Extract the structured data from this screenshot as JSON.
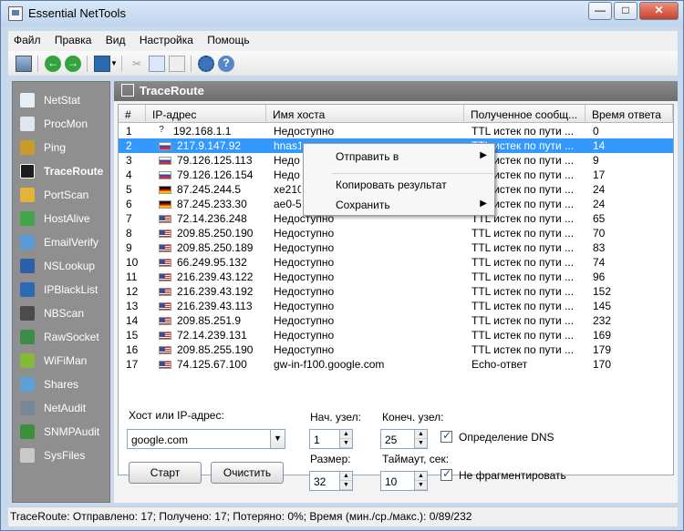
{
  "window": {
    "title": "Essential NetTools",
    "buttons": [
      "—",
      "□",
      "✕"
    ]
  },
  "menu": [
    "Файл",
    "Правка",
    "Вид",
    "Настройка",
    "Помощь"
  ],
  "toolbar": {
    "icons": [
      "computer-icon",
      "back-icon",
      "forward-icon",
      "save-icon",
      "dropdown-icon",
      "cut-icon",
      "copy-icon",
      "paste-icon",
      "settings-icon",
      "help-icon"
    ]
  },
  "sidebar": {
    "items": [
      {
        "label": "NetStat",
        "icon": "netstat-icon",
        "color": "#e6eef7"
      },
      {
        "label": "ProcMon",
        "icon": "procmon-icon",
        "color": "#dfe6f1"
      },
      {
        "label": "Ping",
        "icon": "ping-icon",
        "color": "#c99b2c"
      },
      {
        "label": "TraceRoute",
        "icon": "traceroute-icon",
        "color": "#1d1d1d",
        "active": true
      },
      {
        "label": "PortScan",
        "icon": "portscan-icon",
        "color": "#e5b33a"
      },
      {
        "label": "HostAlive",
        "icon": "hostalive-icon",
        "color": "#41a54b"
      },
      {
        "label": "EmailVerify",
        "icon": "email-icon",
        "color": "#5a9ad6"
      },
      {
        "label": "NSLookup",
        "icon": "nslookup-icon",
        "color": "#2f5da8"
      },
      {
        "label": "IPBlackList",
        "icon": "blacklist-icon",
        "color": "#2f69b2"
      },
      {
        "label": "NBScan",
        "icon": "nbscan-icon",
        "color": "#4b4b4b"
      },
      {
        "label": "RawSocket",
        "icon": "rawsocket-icon",
        "color": "#3e8c4a"
      },
      {
        "label": "WiFiMan",
        "icon": "wifi-icon",
        "color": "#86b93a"
      },
      {
        "label": "Shares",
        "icon": "shares-icon",
        "color": "#5ba1d8"
      },
      {
        "label": "NetAudit",
        "icon": "netaudit-icon",
        "color": "#7b8796"
      },
      {
        "label": "SNMPAudit",
        "icon": "snmp-icon",
        "color": "#3f8e3d"
      },
      {
        "label": "SysFiles",
        "icon": "sysfiles-icon",
        "color": "#c9c9c9"
      }
    ]
  },
  "panel": {
    "title": "TraceRoute"
  },
  "table": {
    "headers": [
      "#",
      "IP-адрес",
      "Имя хоста",
      "Полученное сообщ...",
      "Время ответа"
    ],
    "rows": [
      {
        "n": "1",
        "flag": "unk",
        "ip": "192.168.1.1",
        "host": "Недоступно",
        "msg": "TTL истек по пути ...",
        "time": "0"
      },
      {
        "n": "2",
        "flag": "ru",
        "ip": "217.9.147.92",
        "host": "hnas1.",
        "msg": "TTL истек по пути ...",
        "time": "14",
        "selected": true
      },
      {
        "n": "3",
        "flag": "ru",
        "ip": "79.126.125.113",
        "host": "Недо",
        "msg": "TTL истек по пути ...",
        "time": "9"
      },
      {
        "n": "4",
        "flag": "ru",
        "ip": "79.126.126.154",
        "host": "Недо",
        "msg": "TTL истек по пути ...",
        "time": "17"
      },
      {
        "n": "5",
        "flag": "de",
        "ip": "87.245.244.5",
        "host": "xe210",
        "msg": "TTL истек по пути ...",
        "time": "24"
      },
      {
        "n": "6",
        "flag": "de",
        "ip": "87.245.233.30",
        "host": "ae0-5",
        "msg": "TTL истек по пути ...",
        "time": "24"
      },
      {
        "n": "7",
        "flag": "us",
        "ip": "72.14.236.248",
        "host": "Недоступно",
        "msg": "TTL истек по пути ...",
        "time": "65"
      },
      {
        "n": "8",
        "flag": "us",
        "ip": "209.85.250.190",
        "host": "Недоступно",
        "msg": "TTL истек по пути ...",
        "time": "70"
      },
      {
        "n": "9",
        "flag": "us",
        "ip": "209.85.250.189",
        "host": "Недоступно",
        "msg": "TTL истек по пути ...",
        "time": "83"
      },
      {
        "n": "10",
        "flag": "us",
        "ip": "66.249.95.132",
        "host": "Недоступно",
        "msg": "TTL истек по пути ...",
        "time": "74"
      },
      {
        "n": "11",
        "flag": "us",
        "ip": "216.239.43.122",
        "host": "Недоступно",
        "msg": "TTL истек по пути ...",
        "time": "96"
      },
      {
        "n": "12",
        "flag": "us",
        "ip": "216.239.43.192",
        "host": "Недоступно",
        "msg": "TTL истек по пути ...",
        "time": "152"
      },
      {
        "n": "13",
        "flag": "us",
        "ip": "216.239.43.113",
        "host": "Недоступно",
        "msg": "TTL истек по пути ...",
        "time": "145"
      },
      {
        "n": "14",
        "flag": "us",
        "ip": "209.85.251.9",
        "host": "Недоступно",
        "msg": "TTL истек по пути ...",
        "time": "232"
      },
      {
        "n": "15",
        "flag": "us",
        "ip": "72.14.239.131",
        "host": "Недоступно",
        "msg": "TTL истек по пути ...",
        "time": "169"
      },
      {
        "n": "16",
        "flag": "us",
        "ip": "209.85.255.190",
        "host": "Недоступно",
        "msg": "TTL истек по пути ...",
        "time": "179"
      },
      {
        "n": "17",
        "flag": "us",
        "ip": "74.125.67.100",
        "host": "gw-in-f100.google.com",
        "msg": "Echo-ответ",
        "time": "170"
      }
    ]
  },
  "context_menu": {
    "items": [
      {
        "label": "Отправить в",
        "submenu": true
      },
      {
        "label": "Копировать результат",
        "submenu": false
      },
      {
        "label": "Сохранить",
        "submenu": true
      }
    ]
  },
  "form": {
    "host_label": "Хост или IP-адрес:",
    "host_value": "google.com",
    "start_node_label": "Нач. узел:",
    "start_node_value": "1",
    "end_node_label": "Конеч. узел:",
    "end_node_value": "25",
    "dns_label": "Определение DNS",
    "size_label": "Размер:",
    "size_value": "32",
    "timeout_label": "Таймаут, сек:",
    "timeout_value": "10",
    "fragment_label": "Не фрагментировать",
    "start_button": "Старт",
    "clear_button": "Очистить"
  },
  "status": "TraceRoute: Отправлено: 17; Получено: 17; Потеряно: 0%; Время (мин./ср./макс.): 0/89/232"
}
